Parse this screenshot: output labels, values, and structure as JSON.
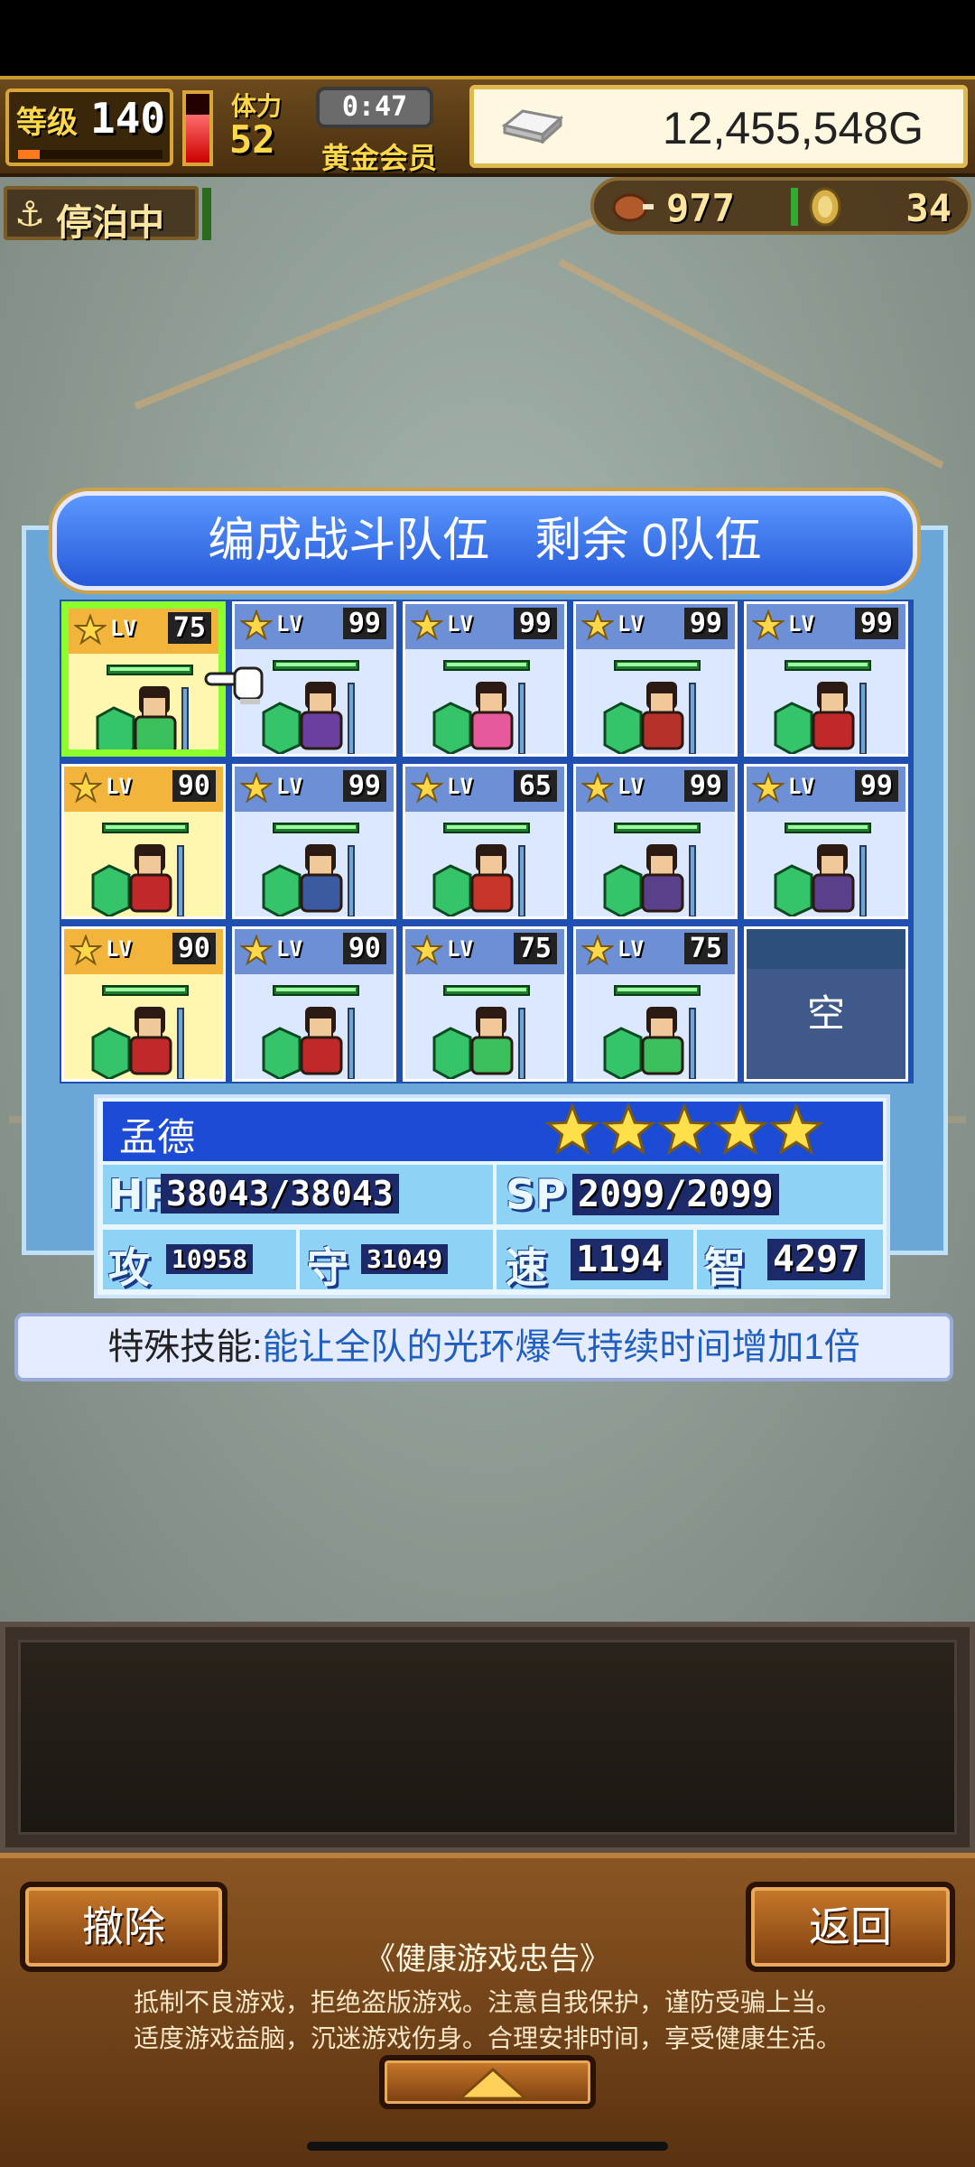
{
  "hud": {
    "level_label": "等级",
    "level_value": "140",
    "level_exp_fraction": 0.15,
    "stamina_label": "体力",
    "stamina_value": "52",
    "stamina_fraction": 0.7,
    "timer": "0:47",
    "membership": "黄金会员",
    "gold": "12,455,548G"
  },
  "status": {
    "anchor_label": "停泊中",
    "food": "977",
    "medals": "34"
  },
  "panel": {
    "title": "编成战斗队伍",
    "remaining": "剩余 0队伍"
  },
  "roster": [
    {
      "level": "75",
      "gold": true,
      "selected": true,
      "color": "#3bbf5a"
    },
    {
      "level": "99",
      "gold": false,
      "color": "#6a3fa0"
    },
    {
      "level": "99",
      "gold": false,
      "color": "#e55a9a"
    },
    {
      "level": "99",
      "gold": false,
      "color": "#b5312a"
    },
    {
      "level": "99",
      "gold": false,
      "color": "#c0282a"
    },
    {
      "level": "90",
      "gold": true,
      "color": "#c0282a"
    },
    {
      "level": "99",
      "gold": false,
      "color": "#3b5aa0"
    },
    {
      "level": "65",
      "gold": false,
      "color": "#c7342a"
    },
    {
      "level": "99",
      "gold": false,
      "color": "#5a3f8a"
    },
    {
      "level": "99",
      "gold": false,
      "color": "#5a3f8a"
    },
    {
      "level": "90",
      "gold": true,
      "color": "#c0282a"
    },
    {
      "level": "90",
      "gold": false,
      "color": "#c0282a"
    },
    {
      "level": "75",
      "gold": false,
      "color": "#3bbf5a"
    },
    {
      "level": "75",
      "gold": false,
      "color": "#3bbf5a"
    },
    {
      "empty": true,
      "label": "空"
    }
  ],
  "lv_text": "LV",
  "info": {
    "name": "孟德",
    "stars": 5,
    "hp_label": "HP",
    "hp": "38043/38043",
    "sp_label": "SP",
    "sp": "2099/2099",
    "atk_label": "攻",
    "atk": "10958",
    "def_label": "守",
    "def": "31049",
    "spd_label": "速",
    "spd": "1194",
    "int_label": "智",
    "int": "4297"
  },
  "skill": {
    "prefix": "特殊技能:",
    "description": "能让全队的光环爆气持续时间增加1倍"
  },
  "buttons": {
    "remove": "撤除",
    "back": "返回"
  },
  "notice": {
    "title": "《健康游戏忠告》",
    "line1": "抵制不良游戏，拒绝盗版游戏。注意自我保护，谨防受骗上当。",
    "line2": "适度游戏益脑，沉迷游戏伤身。合理安排时间，享受健康生活。"
  }
}
